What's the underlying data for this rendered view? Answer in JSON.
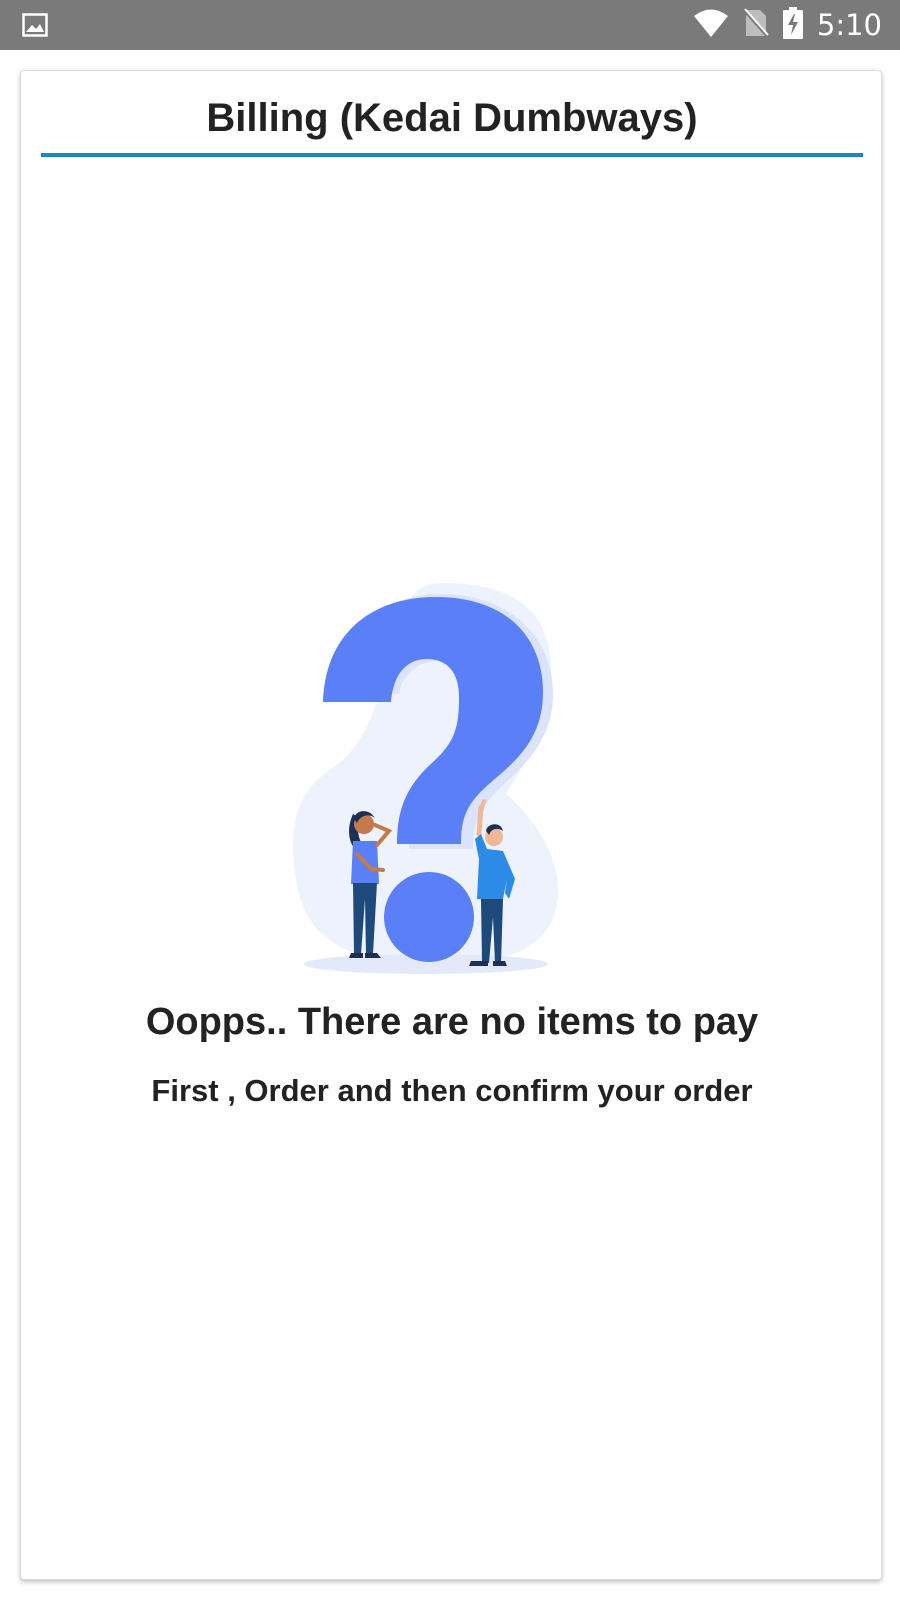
{
  "status_bar": {
    "time": "5:10",
    "icons": [
      "image-icon",
      "wifi-icon",
      "no-sim-icon",
      "battery-charging-icon"
    ]
  },
  "header": {
    "title": "Billing (Kedai Dumbways)",
    "accent_color": "#1a86c8"
  },
  "empty_state": {
    "illustration": "question-mark-people-illustration",
    "title": "Oopps.. There are no items to pay",
    "subtitle": "First , Order and then confirm your order",
    "illustration_color": "#5b7ff7"
  }
}
